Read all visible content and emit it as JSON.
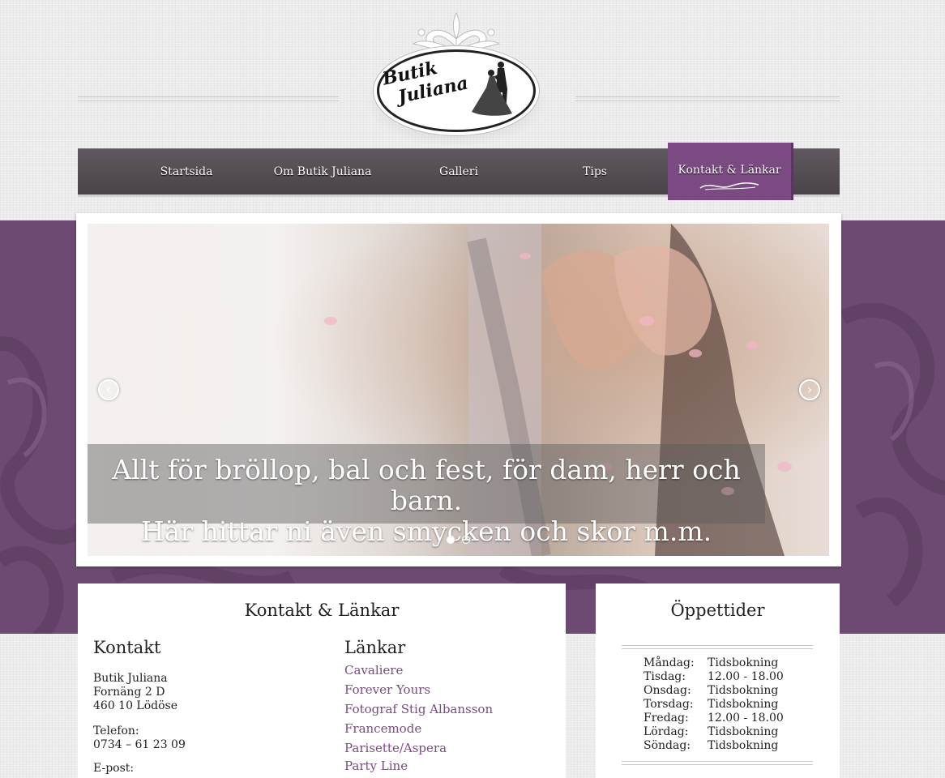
{
  "logo": {
    "line1": "Butik",
    "line2": "Juliana"
  },
  "nav": {
    "items": [
      "Startsida",
      "Om Butik Juliana",
      "Galleri",
      "Tips"
    ],
    "active": "Kontakt & Länkar"
  },
  "slider": {
    "caption_line1": "Allt för bröllop, bal och fest, för dam, herr och barn.",
    "caption_line2": "Här hittar ni även smycken och skor m.m.",
    "prev_icon": "chevron-left-icon",
    "next_icon": "chevron-right-icon",
    "dots": 2,
    "active_dot": 1
  },
  "contact_panel": {
    "title": "Kontakt & Länkar",
    "kontakt_heading": "Kontakt",
    "address": [
      "Butik Juliana",
      "Fornäng 2 D",
      "460 10 Lödöse"
    ],
    "phone_label": "Telefon:",
    "phone": "0734 – 61 23 09",
    "partial_label": "E-post:",
    "links_heading": "Länkar",
    "links": [
      "Cavaliere",
      "Forever Yours",
      "Fotograf Stig Albansson",
      "Francemode",
      "Parisette/Aspera",
      "Party Line"
    ]
  },
  "hours_panel": {
    "title": "Öppettider",
    "rows": [
      {
        "day": "Måndag:",
        "time": "Tidsbokning"
      },
      {
        "day": "Tisdag:",
        "time": "12.00 - 18.00"
      },
      {
        "day": "Onsdag:",
        "time": "Tidsbokning"
      },
      {
        "day": "Torsdag:",
        "time": "Tidsbokning"
      },
      {
        "day": "Fredag:",
        "time": "12.00 - 18.00"
      },
      {
        "day": "Lördag:",
        "time": "Tidsbokning"
      },
      {
        "day": "Söndag:",
        "time": "Tidsbokning"
      }
    ]
  },
  "colors": {
    "accent": "#7b4a83",
    "nav_bg": "#544e53",
    "band": "#6d4a72"
  }
}
